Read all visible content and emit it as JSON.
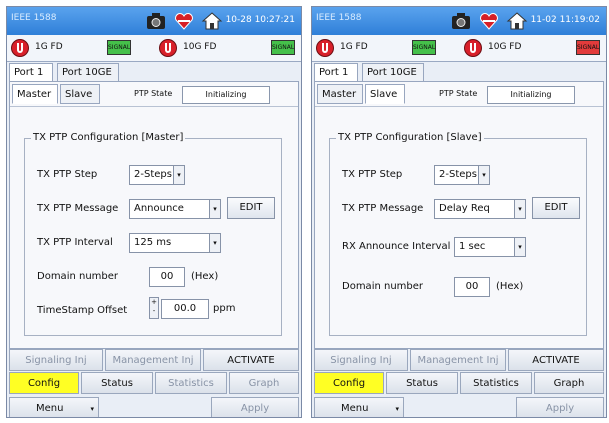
{
  "panels": [
    {
      "app_title": "IEEE 1588",
      "timestamp": "10-28 10:27:21",
      "ports": [
        {
          "label": "1G FD",
          "status": "green",
          "led_text": "SIGNAL"
        },
        {
          "label": "10G FD",
          "status": "green",
          "led_text": "SIGNAL"
        }
      ],
      "port_tabs": [
        "Port 1",
        "Port 10GE"
      ],
      "mode_tabs": [
        "Master",
        "Slave"
      ],
      "active_mode": "Master",
      "ptp_state_label": "PTP State",
      "ptp_state_value": "Initializing",
      "group_title": "TX PTP Configuration [Master]",
      "rows": {
        "step_label": "TX PTP Step",
        "step_value": "2-Steps",
        "message_label": "TX PTP Message",
        "message_value": "Announce",
        "edit_label": "EDIT",
        "interval_label": "TX PTP Interval",
        "interval_value": "125 ms",
        "domain_label": "Domain number",
        "domain_value": "00",
        "domain_unit": "(Hex)",
        "offset_label": "TimeStamp Offset",
        "offset_value": "00.0",
        "offset_unit": "ppm"
      },
      "actions": [
        "Signaling Inj",
        "Management Inj",
        "ACTIVATE"
      ],
      "tabs": [
        "Config",
        "Status",
        "Statistics",
        "Graph"
      ],
      "menu_label": "Menu",
      "apply_label": "Apply"
    },
    {
      "app_title": "IEEE 1588",
      "timestamp": "11-02 11:19:02",
      "ports": [
        {
          "label": "1G FD",
          "status": "green",
          "led_text": "SIGNAL"
        },
        {
          "label": "10G FD",
          "status": "red",
          "led_text": "SIGNAL"
        }
      ],
      "port_tabs": [
        "Port 1",
        "Port 10GE"
      ],
      "mode_tabs": [
        "Master",
        "Slave"
      ],
      "active_mode": "Slave",
      "ptp_state_label": "PTP State",
      "ptp_state_value": "Initializing",
      "group_title": "TX PTP Configuration [Slave]",
      "rows": {
        "step_label": "TX PTP Step",
        "step_value": "2-Steps",
        "message_label": "TX PTP Message",
        "message_value": "Delay Req",
        "edit_label": "EDIT",
        "rx_label": "RX Announce Interval",
        "rx_value": "1 sec",
        "domain_label": "Domain number",
        "domain_value": "00",
        "domain_unit": "(Hex)"
      },
      "actions": [
        "Signaling Inj",
        "Management Inj",
        "ACTIVATE"
      ],
      "tabs": [
        "Config",
        "Status",
        "Statistics",
        "Graph"
      ],
      "menu_label": "Menu",
      "apply_label": "Apply"
    }
  ],
  "colors": {
    "title_bar": "#2f7fd8",
    "active_tab": "#ffff24",
    "port_alarm": "#d8202a",
    "led_green": "#45c04a",
    "led_red": "#e23b3b"
  },
  "icons": [
    "camera-icon",
    "heart-icon",
    "home-icon",
    "port-status-icon",
    "dropdown-arrow-icon"
  ]
}
